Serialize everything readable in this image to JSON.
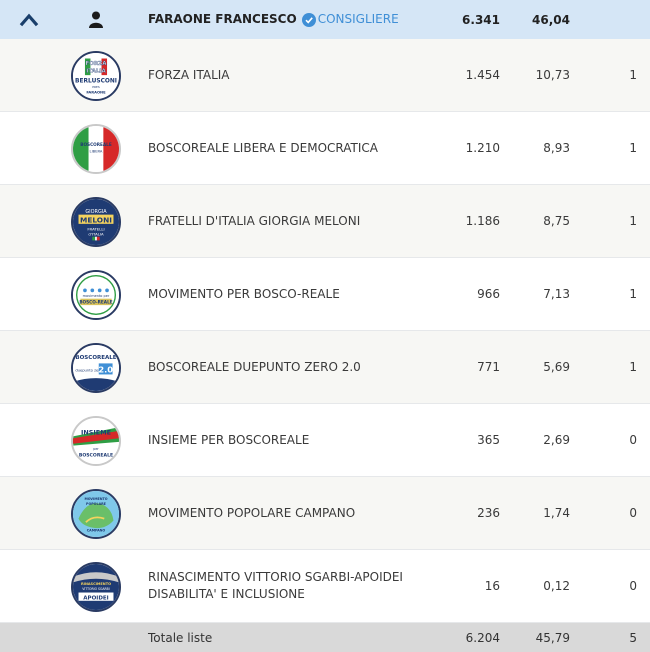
{
  "candidate": {
    "name": "FARAONE FRANCESCO",
    "role": "CONSIGLIERE",
    "votes": "6.341",
    "percent": "46,04"
  },
  "lists": [
    {
      "name": "FORZA ITALIA",
      "votes": "1.454",
      "percent": "10,73",
      "seats": "1",
      "logo_icon": "forza-italia-logo-icon",
      "logo_text": [
        "FORZA",
        "ITALIA",
        "BERLUSCONI",
        "PRES",
        "FARAONE"
      ]
    },
    {
      "name": "BOSCOREALE LIBERA E DEMOCRATICA",
      "votes": "1.210",
      "percent": "8,93",
      "seats": "1",
      "logo_icon": "boscoreale-libera-logo-icon",
      "logo_text": [
        "BOSCOREALE",
        "LIBERA"
      ]
    },
    {
      "name": "FRATELLI D'ITALIA GIORGIA MELONI",
      "votes": "1.186",
      "percent": "8,75",
      "seats": "1",
      "logo_icon": "fratelli-italia-logo-icon",
      "logo_text": [
        "GIORGIA",
        "MELONI",
        "FRATELLI",
        "d'ITALIA"
      ]
    },
    {
      "name": "MOVIMENTO PER BOSCO-REALE",
      "votes": "966",
      "percent": "7,13",
      "seats": "1",
      "logo_icon": "movimento-bosco-reale-logo-icon",
      "logo_text": [
        "movimento per",
        "BOSCO-REALE"
      ]
    },
    {
      "name": "BOSCOREALE DUEPUNTO ZERO 2.0",
      "votes": "771",
      "percent": "5,69",
      "seats": "1",
      "logo_icon": "boscoreale-duepunto-logo-icon",
      "logo_text": [
        "BOSCOREALE",
        "duepunto zero",
        "2.0"
      ]
    },
    {
      "name": "INSIEME PER BOSCOREALE",
      "votes": "365",
      "percent": "2,69",
      "seats": "0",
      "logo_icon": "insieme-boscoreale-logo-icon",
      "logo_text": [
        "INSIEME",
        "per",
        "BOSCOREALE"
      ]
    },
    {
      "name": "MOVIMENTO POPOLARE CAMPANO",
      "votes": "236",
      "percent": "1,74",
      "seats": "0",
      "logo_icon": "movimento-popolare-campano-logo-icon",
      "logo_text": [
        "MOVIMENTO",
        "POPOLARE",
        "CAMPANO"
      ]
    },
    {
      "name": "RINASCIMENTO VITTORIO SGARBI-APOIDEI DISABILITA' E INCLUSIONE",
      "votes": "16",
      "percent": "0,12",
      "seats": "0",
      "logo_icon": "rinascimento-apoidei-logo-icon",
      "logo_text": [
        "RINASCIMENTO",
        "VITTORIO SGARBI",
        "APOIDEI"
      ]
    }
  ],
  "totals": {
    "label": "Totale liste",
    "votes": "6.204",
    "percent": "45,79",
    "seats": "5"
  },
  "colors": {
    "header_bg": "#d5e6f6",
    "accent": "#3f8fd6",
    "row_alt": "#f7f7f4",
    "footer_bg": "#d9d9d9",
    "chevron": "#1a3f6b"
  },
  "icons": {
    "collapse": "chevron-up-icon",
    "person": "person-icon",
    "verified": "check-circle-icon"
  }
}
